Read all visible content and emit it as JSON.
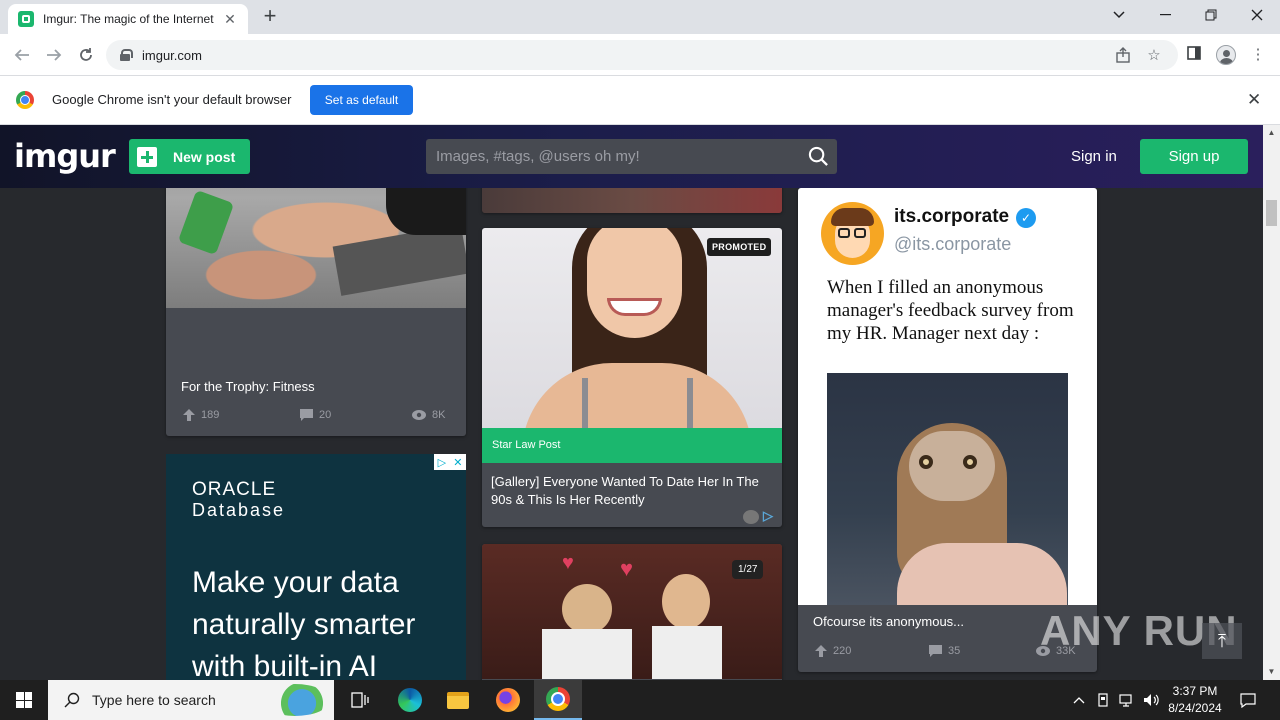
{
  "browser": {
    "tab_title": "Imgur: The magic of the Internet",
    "url": "imgur.com",
    "infobar_text": "Google Chrome isn't your default browser",
    "set_default_label": "Set as default"
  },
  "imgur": {
    "logo": "imgur",
    "new_post_label": "New post",
    "search_placeholder": "Images, #tags, @users oh my!",
    "sign_in_label": "Sign in",
    "sign_up_label": "Sign up",
    "brand_green": "#1bb76e"
  },
  "cards": {
    "fitness": {
      "title": "For the Trophy: Fitness",
      "upvotes": "189",
      "comments": "20",
      "views": "8K"
    },
    "promoted": {
      "badge": "PROMOTED",
      "source": "Star Law Post",
      "title": "[Gallery] Everyone Wanted To Date Her In The 90s & This Is Her Recently"
    },
    "owl": {
      "handle_name": "its.corporate",
      "handle_at": "@its.corporate",
      "meme_text": "When I filled an anonymous manager's feedback survey from my HR. Manager next day :",
      "title": "Ofcourse its anonymous...",
      "upvotes": "220",
      "comments": "35",
      "views": "33K"
    },
    "valentine": {
      "badge": "1/27"
    },
    "ad": {
      "brand": "ORACLE",
      "product": "Database",
      "headline": "Make your data naturally smarter with built-in AI"
    }
  },
  "watermark": "ANY RUN",
  "taskbar": {
    "search_placeholder": "Type here to search",
    "time": "3:37 PM",
    "date": "8/24/2024"
  }
}
